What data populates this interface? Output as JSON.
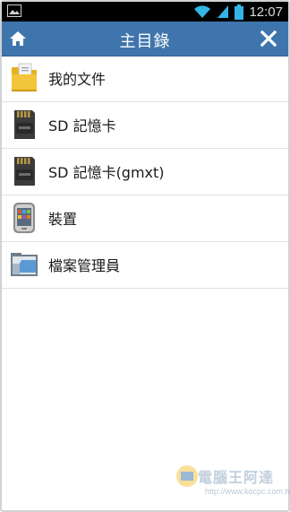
{
  "status": {
    "time": "12:07"
  },
  "header": {
    "title": "主目錄"
  },
  "items": [
    {
      "label": "我的文件",
      "icon": "folder-document-icon"
    },
    {
      "label": "SD 記憶卡",
      "icon": "sd-card-icon"
    },
    {
      "label": "SD 記憶卡(gmxt)",
      "icon": "sd-card-icon"
    },
    {
      "label": "裝置",
      "icon": "phone-device-icon"
    },
    {
      "label": "檔案管理員",
      "icon": "file-manager-icon"
    }
  ],
  "watermark": {
    "title": "電腦王阿達",
    "url": "http://www.kocpc.com.tw"
  },
  "colors": {
    "accent": "#3f75ad",
    "statusbar": "#000000",
    "background": "#ffffff"
  }
}
